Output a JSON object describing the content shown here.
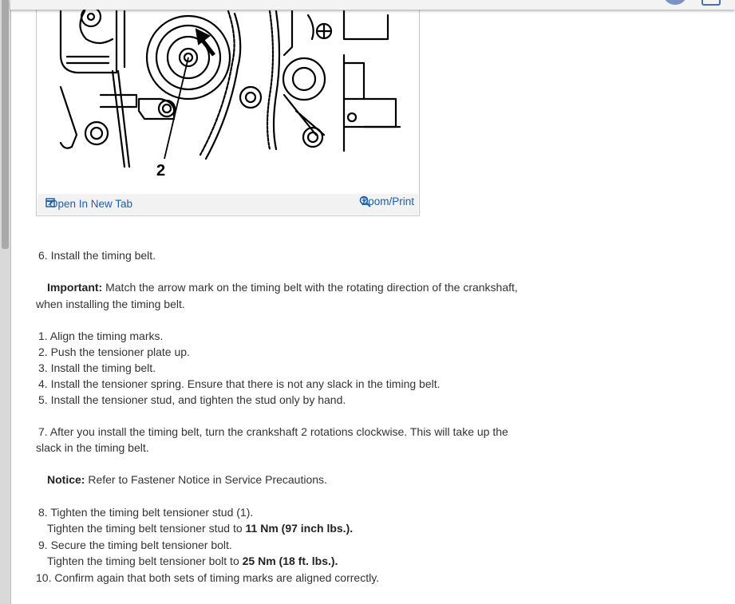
{
  "figure": {
    "callout_label": "2",
    "open_link_label": "Open In New Tab",
    "zoom_link_label": "Zoom/Print"
  },
  "steps": {
    "s6": "6. Install the timing belt.",
    "important_label": "Important:",
    "important_text_1": " Match the arrow mark on the timing belt with the rotating direction of the crankshaft,",
    "important_text_2": "when installing the timing belt.",
    "sub1": "1. Align the timing marks.",
    "sub2": "2. Push the tensioner plate up.",
    "sub3": "3. Install the timing belt.",
    "sub4": "4. Install the tensioner spring. Ensure that there is not any slack in the timing belt.",
    "sub5": "5. Install the tensioner stud, and tighten the stud only by hand.",
    "s7_1": "7. After you install the timing belt, turn the crankshaft 2 rotations clockwise. This will take up the",
    "s7_2": "slack in the timing belt.",
    "notice_label": "Notice:",
    "notice_text": " Refer to Fastener Notice in Service Precautions.",
    "s8": "8. Tighten the timing belt tensioner stud (1).",
    "s8_spec_text": "Tighten the timing belt tensioner stud to ",
    "s8_spec_value": "11 Nm (97 inch lbs.).",
    "s9": "9. Secure the timing belt tensioner bolt.",
    "s9_spec_text": "Tighten the timing belt tensioner bolt to ",
    "s9_spec_value": "25 Nm (18 ft. lbs.).",
    "s10": "10. Confirm again that both sets of timing marks are aligned correctly."
  }
}
